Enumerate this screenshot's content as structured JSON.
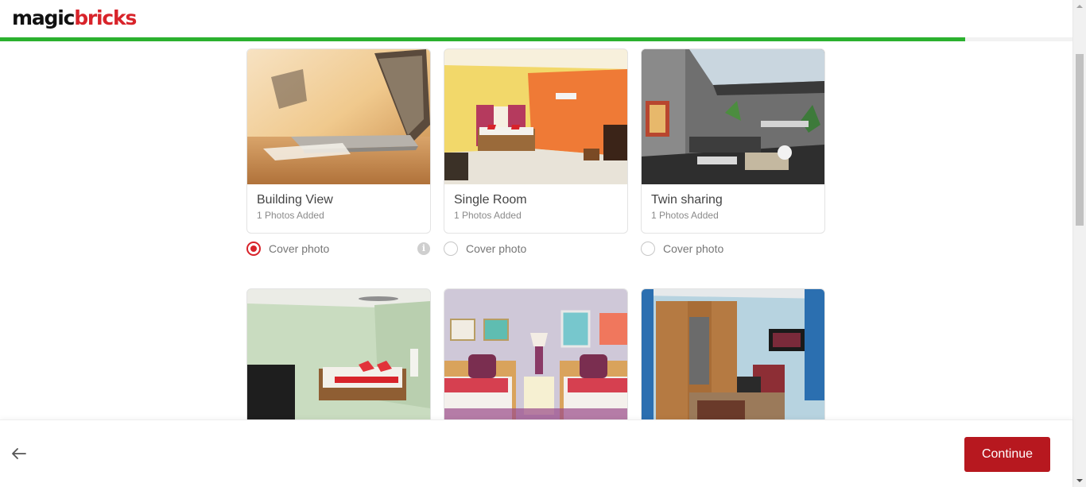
{
  "header": {
    "logo_part1": "magic",
    "logo_part2": "bricks",
    "progress_fraction": 0.9
  },
  "cards": [
    {
      "title": "Building View",
      "subtitle": "1 Photos Added",
      "cover_label": "Cover photo",
      "cover_selected": true,
      "show_info": true,
      "info_glyph": "i",
      "image": "laptop-on-desk"
    },
    {
      "title": "Single Room",
      "subtitle": "1 Photos Added",
      "cover_label": "Cover photo",
      "cover_selected": false,
      "image": "orange-bedroom"
    },
    {
      "title": "Twin sharing",
      "subtitle": "1 Photos Added",
      "cover_label": "Cover photo",
      "cover_selected": false,
      "image": "modern-interior"
    },
    {
      "image": "green-bedroom"
    },
    {
      "image": "twin-bedroom"
    },
    {
      "image": "wardrobe-room"
    }
  ],
  "footer": {
    "back_icon": "arrow-left-icon",
    "continue_label": "Continue"
  },
  "colors": {
    "brand_red": "#d8232a",
    "button_red": "#b7181f",
    "progress_green": "#2bb12f"
  }
}
